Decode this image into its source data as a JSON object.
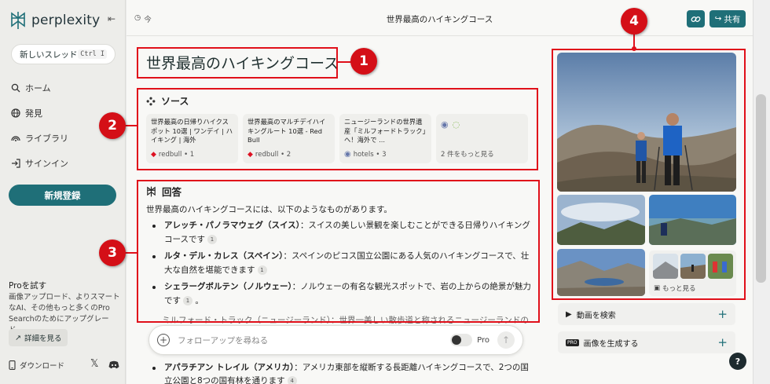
{
  "sidebar": {
    "logo_text": "perplexity",
    "new_thread": {
      "label": "新しいスレッド",
      "shortcut": "Ctrl I"
    },
    "nav": [
      {
        "label": "ホーム",
        "icon": "search-icon"
      },
      {
        "label": "発見",
        "icon": "globe-icon"
      },
      {
        "label": "ライブラリ",
        "icon": "library-icon"
      },
      {
        "label": "サインイン",
        "icon": "sign-in-icon"
      }
    ],
    "signup_label": "新規登録",
    "pro": {
      "title": "Proを試す",
      "description": "画像アップロード、よりスマートなAI、その他もっと多くのPro Searchのためにアップグレード。",
      "more_label": "詳細を見る"
    },
    "download_label": "ダウンロード"
  },
  "header": {
    "time": "今",
    "title": "世界最高のハイキングコース",
    "share_label": "共有"
  },
  "main": {
    "query_title": "世界最高のハイキングコース",
    "sources": {
      "heading": "ソース",
      "cards": [
        {
          "text": "世界最高の日帰りハイクスポット 10選 | ワンデイ | ハイキング | 海外",
          "meta": "redbull • 1"
        },
        {
          "text": "世界最高のマルチデイハイキングルート 10選 - Red Bull",
          "meta": "redbull • 2"
        },
        {
          "text": "ニュージーランドの世界遺産「ミルフォードトラック」へ！海外で ...",
          "meta": "hotels • 3"
        }
      ],
      "more_label": "2 件をもっと見る"
    },
    "answer": {
      "heading": "回答",
      "intro": "世界最高のハイキングコースには、以下のようなものがあります。",
      "items": [
        {
          "name": "アレッチ・パノラマウェグ（スイス）",
          "text": "：スイスの美しい景観を楽しむことができる日帰りハイキングコースです",
          "cite": "1"
        },
        {
          "name": "ルタ・デル・カレス（スペイン）",
          "text": "：スペインのピコス国立公園にある人気のハイキングコースで、壮大な自然を堪能できます",
          "cite": "1"
        },
        {
          "name": "シェラーグボルテン（ノルウェー）",
          "text": "：ノルウェーの有名な観光スポットで、岩の上からの絶景が魅力です",
          "cite": "1"
        }
      ],
      "hidden_line": "ミルフォード・トラック（ニュージーランド）：世界一美しい散歩道と称されるニュージーランドの...",
      "last_item": {
        "name": "アパラチアン トレイル（アメリカ）",
        "text": "：アメリカ東部を縦断する長距離ハイキングコースで、2つの国立公園と8つの国有林を通ります",
        "cite": "4"
      }
    },
    "followup": {
      "placeholder": "フォローアップを尋ねる",
      "pro_label": "Pro"
    }
  },
  "right_panel": {
    "more_images_label": "もっと見る",
    "actions": [
      {
        "label": "動画を検索",
        "icon": "video-icon"
      },
      {
        "label": "画像を生成する",
        "icon": "pro-badge-icon"
      }
    ]
  },
  "annotations": [
    "1",
    "2",
    "3",
    "4"
  ],
  "colors": {
    "accent": "#1f6f78",
    "annotation_red": "#e0101a",
    "sidebar_bg": "#ededea",
    "main_bg": "#f8f8f6"
  }
}
